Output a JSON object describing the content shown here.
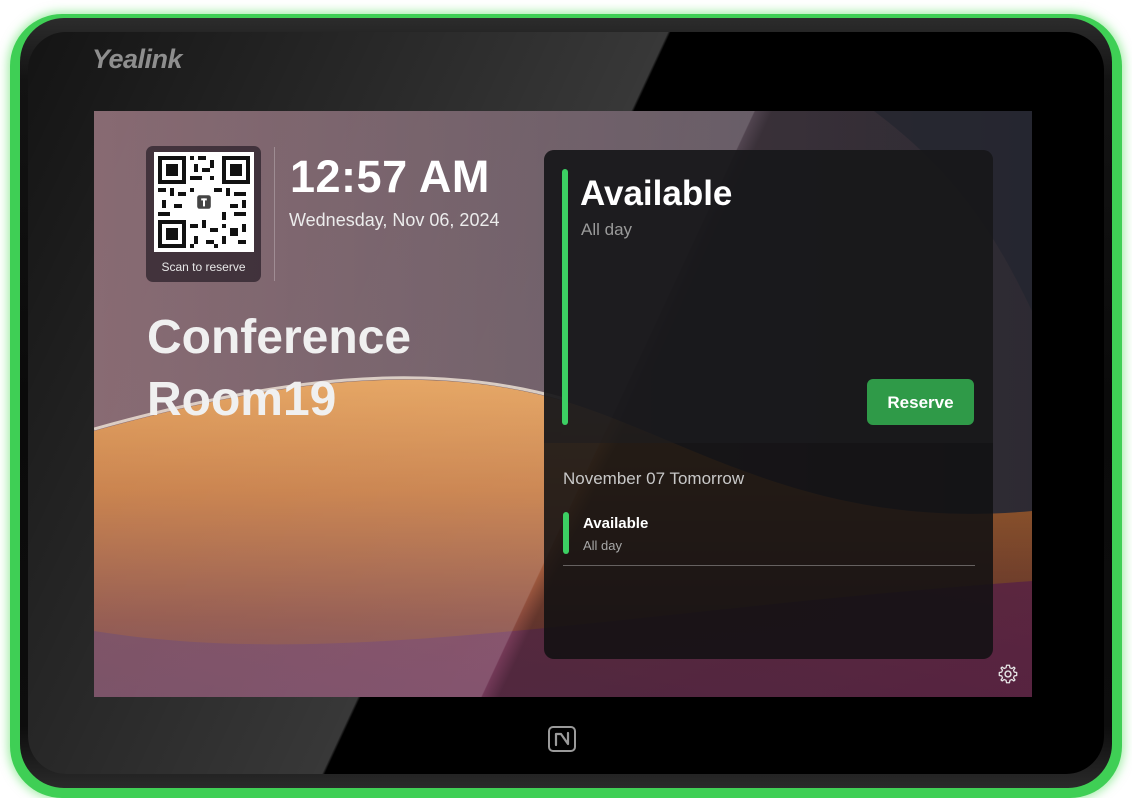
{
  "device": {
    "brand": "Yealink",
    "accent_color": "#3fcf55"
  },
  "qr": {
    "label": "Scan to reserve"
  },
  "clock": {
    "time": "12:57 AM",
    "date": "Wednesday, Nov 06, 2024"
  },
  "room": {
    "line1": "Conference",
    "line2": "Room19"
  },
  "current": {
    "status": "Available",
    "period": "All day",
    "status_color": "#3ccf63",
    "reserve_label": "Reserve"
  },
  "upcoming": {
    "heading": "November 07 Tomorrow",
    "events": [
      {
        "status": "Available",
        "period": "All day"
      }
    ]
  },
  "icons": {
    "settings": "settings-icon",
    "nfc": "nfc-icon",
    "qr": "qr-code"
  }
}
